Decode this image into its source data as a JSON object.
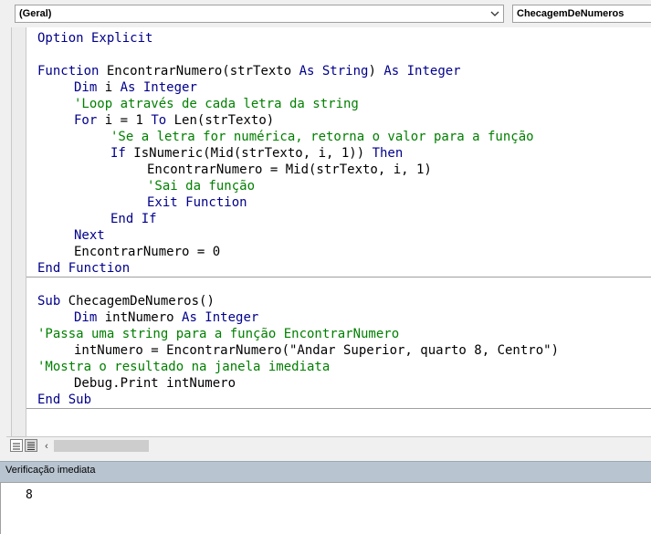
{
  "procedure_combo": {
    "value": "(Geral)"
  },
  "procedure_combo_right": {
    "value": "ChecagemDeNumeros"
  },
  "code": {
    "l1": {
      "kw1": "Option Explicit"
    },
    "l2": {
      "kw1": "Function",
      "t1": " EncontrarNumero(strTexto ",
      "kw2": "As String",
      "t2": ") ",
      "kw3": "As Integer"
    },
    "l3": {
      "kw1": "Dim",
      "t1": " i ",
      "kw2": "As Integer"
    },
    "l4": {
      "cm": "'Loop através de cada letra da string"
    },
    "l5": {
      "kw1": "For",
      "t1": " i = 1 ",
      "kw2": "To",
      "t2": " Len(strTexto)"
    },
    "l6": {
      "cm": "'Se a letra for numérica, retorna o valor para a função"
    },
    "l7": {
      "kw1": "If",
      "t1": " IsNumeric(Mid(strTexto, i, 1)) ",
      "kw2": "Then"
    },
    "l8": {
      "t1": "EncontrarNumero = Mid(strTexto, i, 1)"
    },
    "l9": {
      "cm": "'Sai da função"
    },
    "l10": {
      "kw1": "Exit Function"
    },
    "l11": {
      "kw1": "End If"
    },
    "l12": {
      "kw1": "Next"
    },
    "l13": {
      "t1": "EncontrarNumero = 0"
    },
    "l14": {
      "kw1": "End Function"
    },
    "l15": {
      "kw1": "Sub",
      "t1": " ChecagemDeNumeros()"
    },
    "l16": {
      "kw1": "Dim",
      "t1": " intNumero ",
      "kw2": "As Integer"
    },
    "l17": {
      "cm": "'Passa uma string para a função EncontrarNumero"
    },
    "l18": {
      "t1": "intNumero = EncontrarNumero(\"Andar Superior, quarto 8, Centro\")"
    },
    "l19": {
      "cm": "'Mostra o resultado na janela imediata"
    },
    "l20": {
      "t1": "Debug.Print intNumero"
    },
    "l21": {
      "kw1": "End Sub"
    }
  },
  "immediate": {
    "title": "Verificação imediata",
    "output": "8"
  },
  "colors": {
    "keyword": "#00008b",
    "comment": "#008000",
    "text": "#000000"
  }
}
